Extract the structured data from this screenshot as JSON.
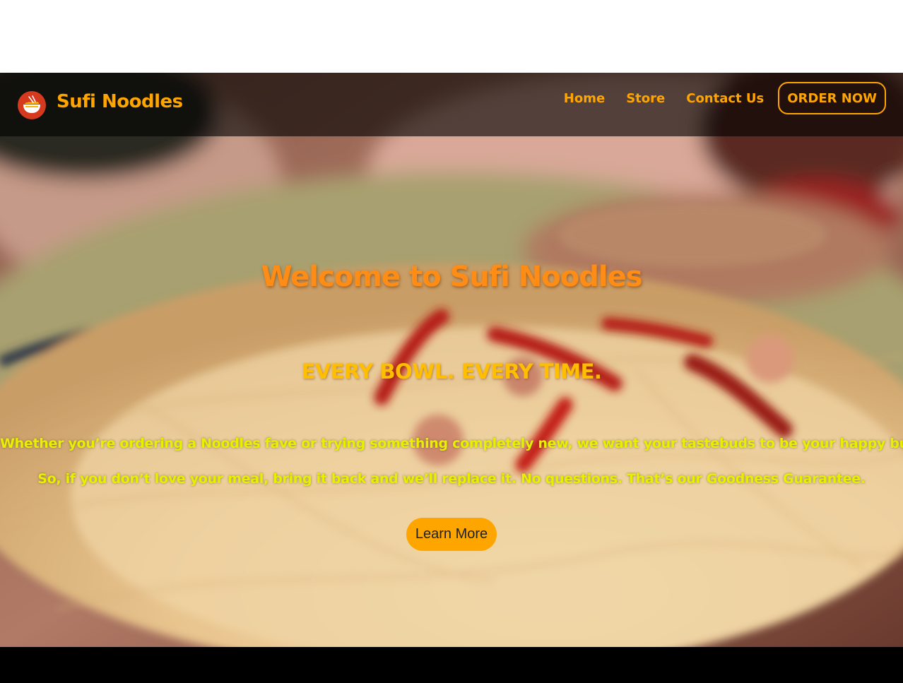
{
  "header": {
    "brand": "Sufi Noodles",
    "logo_icon": "noodle-bowl-icon",
    "nav": [
      "Home",
      "Store",
      "Contact Us"
    ],
    "order_button": "ORDER NOW"
  },
  "hero": {
    "background": "blurred plate of spaghetti with red chili peppers",
    "title": "Welcome to Sufi Noodles",
    "tagline": "EVERY BOWL. EVERY TIME.",
    "paragraph_1": "Whether you’re ordering a Noodles fave or trying something completely new, we want your tastebuds to be your happy buds.",
    "paragraph_2": "So, if you don’t love your meal, bring it back and we’ll replace it. No questions. That’s our Goodness Guarantee.",
    "cta": "Learn More"
  },
  "colors": {
    "accent": "#ffa500",
    "title": "#ff8c14",
    "tagline": "#ffbf00",
    "body_text": "#e8f000",
    "footer": "#000000"
  }
}
